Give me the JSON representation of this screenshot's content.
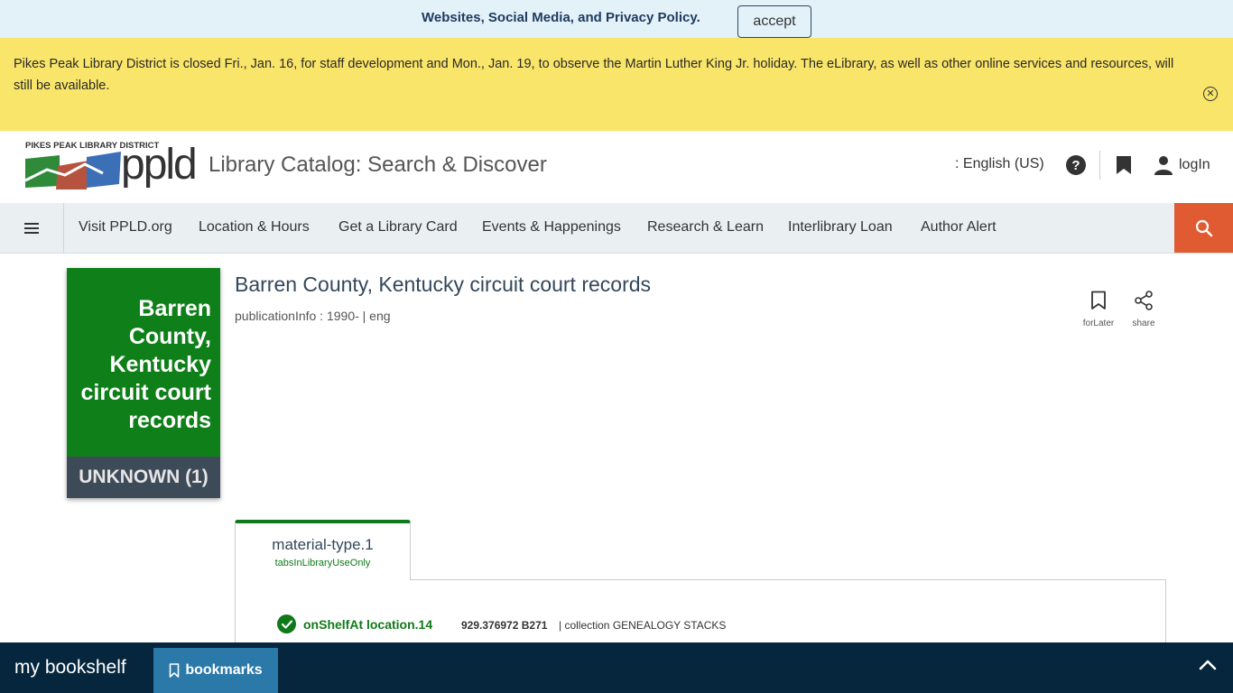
{
  "cookie_banner": {
    "text": "Websites, Social Media, and Privacy Policy.",
    "accept_label": "accept"
  },
  "alert": {
    "text": "Pikes Peak Library District is closed Fri., Jan. 16, for staff development and Mon., Jan. 19, to observe the Martin Luther King Jr. holiday. The eLibrary, as well as other online services and resources, will still be available."
  },
  "header": {
    "logo_tagline": "PIKES PEAK LIBRARY DISTRICT",
    "logo_wordmark": "ppld",
    "catalog_title": "Library Catalog: Search & Discover",
    "language": ": English (US)",
    "login_label": "logIn"
  },
  "nav": {
    "items": [
      "Visit PPLD.org",
      "Location & Hours",
      "Get a Library Card",
      "Events & Happenings",
      "Research & Learn",
      "Interlibrary Loan",
      "Author Alert"
    ]
  },
  "record": {
    "cover_title": "Barren County, Kentucky circuit court records",
    "cover_format": "UNKNOWN (1)",
    "title": "Barren County, Kentucky circuit court records",
    "publication_info": "publicationInfo : 1990- | eng",
    "actions": {
      "for_later": "forLater",
      "share": "share"
    }
  },
  "availability": {
    "tab_label": "material-type.1",
    "tab_sub": "tabsInLibraryUseOnly",
    "status": "onShelfAt location.14",
    "call_number": "929.376972 B271",
    "collection": "| collection GENEALOGY STACKS"
  },
  "bookshelf": {
    "title": "my bookshelf",
    "bookmarks_label": "bookmarks"
  },
  "colors": {
    "cover_green": "#0f8019",
    "search_orange": "#e05a32",
    "alert_yellow": "#f9e569",
    "shelf_navy": "#05263c",
    "bookmarks_blue": "#2b79a8"
  },
  "icons": [
    "close-circle-icon",
    "help-icon",
    "bookmark-icon",
    "user-icon",
    "hamburger-icon",
    "search-icon",
    "share-icon",
    "check-circle-icon",
    "chevron-up-icon"
  ]
}
